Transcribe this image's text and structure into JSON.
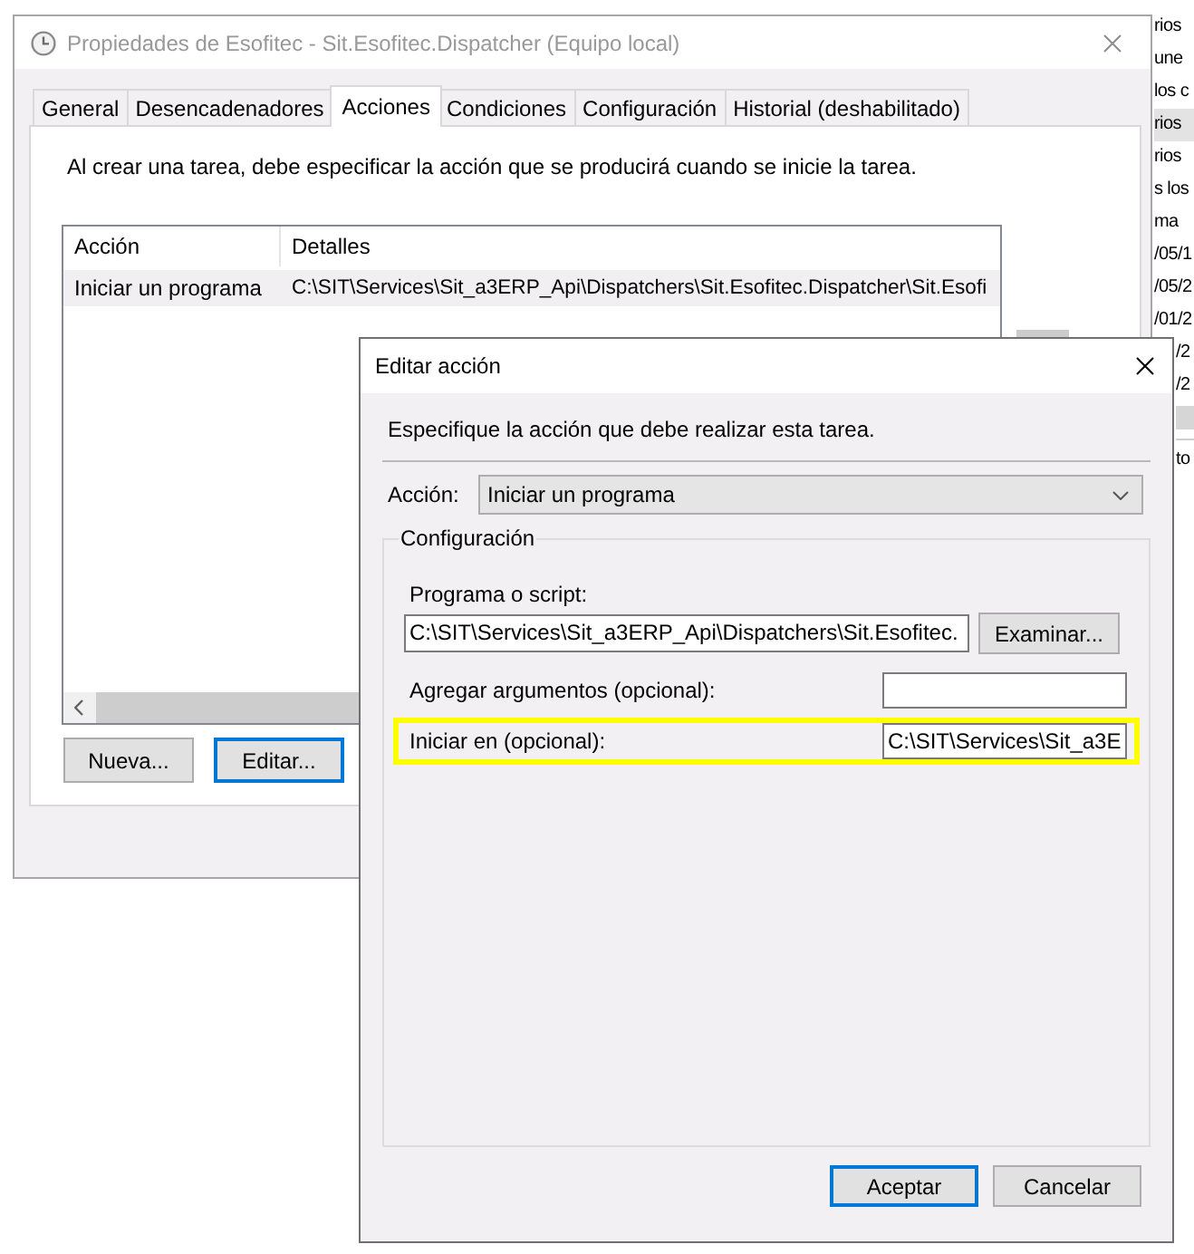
{
  "background_window": {
    "rows": [
      {
        "text": "rios",
        "selected": false
      },
      {
        "text": "une",
        "selected": false
      },
      {
        "text": "los c",
        "selected": false
      },
      {
        "text": "rios",
        "selected": true
      },
      {
        "text": "rios",
        "selected": false
      },
      {
        "text": "s los",
        "selected": false
      },
      {
        "text": "ma",
        "selected": false
      },
      {
        "text": "/05/1",
        "selected": false
      },
      {
        "text": "/05/2",
        "selected": false
      },
      {
        "text": "/01/2",
        "selected": false
      },
      {
        "text": "/2",
        "selected": false
      },
      {
        "text": "/2",
        "selected": false
      }
    ],
    "lower_text": "to"
  },
  "window": {
    "title": "Propiedades de Esofitec - Sit.Esofitec.Dispatcher (Equipo local)",
    "active": false,
    "tabs": [
      {
        "label": "General",
        "selected": false
      },
      {
        "label": "Desencadenadores",
        "selected": false
      },
      {
        "label": "Acciones",
        "selected": true
      },
      {
        "label": "Condiciones",
        "selected": false
      },
      {
        "label": "Configuración",
        "selected": false
      },
      {
        "label": "Historial (deshabilitado)",
        "selected": false
      }
    ],
    "description": "Al crear una tarea, debe especificar la acción que se producirá cuando se inicie la tarea.",
    "actions_table": {
      "columns": [
        "Acción",
        "Detalles"
      ],
      "rows": [
        {
          "cells": [
            "Iniciar un programa",
            "C:\\SIT\\Services\\Sit_a3ERP_Api\\Dispatchers\\Sit.Esofitec.Dispatcher\\Sit.Esofi"
          ],
          "selected": true
        }
      ]
    },
    "buttons": [
      {
        "label": "Nueva...",
        "focused": false
      },
      {
        "label": "Editar...",
        "focused": true
      }
    ]
  },
  "dialog": {
    "title": "Editar acción",
    "active": true,
    "instruction": "Especifique la acción que debe realizar esta tarea.",
    "action": {
      "label": "Acción:",
      "value": "Iniciar un programa"
    },
    "settings": {
      "legend": "Configuración",
      "fields": [
        {
          "kind": "stacked",
          "label": "Programa o script:",
          "value": "C:\\SIT\\Services\\Sit_a3ERP_Api\\Dispatchers\\Sit.Esofitec.",
          "button": "Examinar...",
          "highlighted": false
        },
        {
          "kind": "inline",
          "label": "Agregar argumentos (opcional):",
          "highlighted": false
        },
        {
          "kind": "inline",
          "label": "Iniciar en (opcional):",
          "value": "C:\\SIT\\Services\\Sit_a3E",
          "highlighted": true
        }
      ]
    },
    "buttons": [
      {
        "label": "Aceptar",
        "focused": true
      },
      {
        "label": "Cancelar",
        "focused": false
      }
    ]
  }
}
